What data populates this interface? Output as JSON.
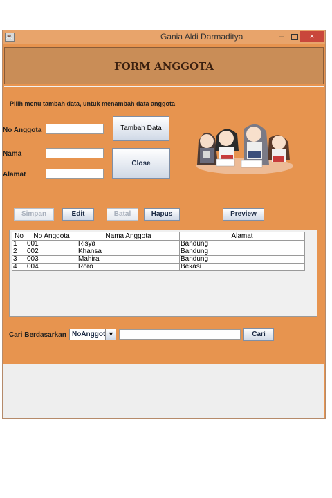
{
  "window": {
    "title": "Gania Aldi Darmaditya",
    "minimize": "–",
    "maximize": "▫",
    "close": "×"
  },
  "header": {
    "title": "FORM ANGGOTA"
  },
  "instruction": "Pilih menu tambah data, untuk menambah data anggota",
  "form": {
    "no_anggota_label": "No Anggota",
    "nama_label": "Nama",
    "alamat_label": "Alamat",
    "no_anggota_value": "",
    "nama_value": "",
    "alamat_value": ""
  },
  "buttons": {
    "tambah_data": "Tambah Data",
    "close": "Close",
    "simpan": "Simpan",
    "edit": "Edit",
    "batal": "Batal",
    "hapus": "Hapus",
    "preview": "Preview",
    "cari": "Cari"
  },
  "table": {
    "columns": [
      "No",
      "No Anggota",
      "Nama Anggota",
      "Alamat"
    ],
    "rows": [
      [
        "1",
        "001",
        "Risya",
        "Bandung"
      ],
      [
        "2",
        "002",
        "Khansa",
        "Bandung"
      ],
      [
        "3",
        "003",
        "Mahira",
        "Bandung"
      ],
      [
        "4",
        "004",
        "Roro",
        "Bekasi"
      ]
    ]
  },
  "search": {
    "label": "Cari Berdasarkan",
    "selected_option": "NoAnggota",
    "value": ""
  },
  "icons": {
    "app": "java-app-icon",
    "dropdown": "chevron-down-icon",
    "illustration": "anime-characters-illustration"
  }
}
